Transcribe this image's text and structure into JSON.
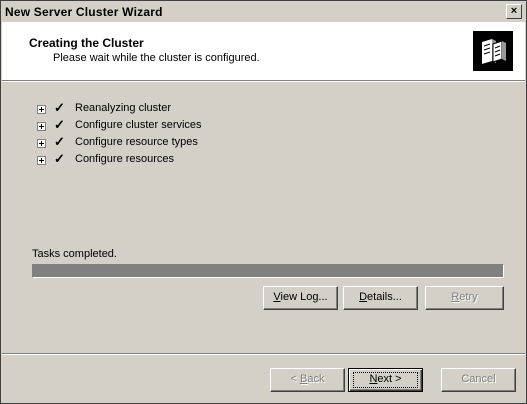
{
  "window": {
    "title": "New Server Cluster Wizard",
    "close_glyph": "×"
  },
  "header": {
    "title": "Creating the Cluster",
    "subtitle": "Please wait while the cluster is configured.",
    "icon": "cluster-server-icon"
  },
  "tasks": [
    {
      "label": "Reanalyzing cluster",
      "status": "completed"
    },
    {
      "label": "Configure cluster services",
      "status": "completed"
    },
    {
      "label": "Configure resource types",
      "status": "completed"
    },
    {
      "label": "Configure resources",
      "status": "completed"
    }
  ],
  "status_text": "Tasks completed.",
  "progress": {
    "percent": 100
  },
  "action_buttons": {
    "view_log": {
      "label": "iew Log...",
      "accel": "V"
    },
    "details": {
      "label": "etails...",
      "accel": "D"
    },
    "retry": {
      "label": "etry",
      "accel": "R",
      "enabled": false
    }
  },
  "nav_buttons": {
    "back": {
      "prefix": "< ",
      "accel": "B",
      "label": "ack",
      "enabled": false
    },
    "next": {
      "accel": "N",
      "label": "ext >",
      "enabled": true
    },
    "cancel": {
      "label": "Cancel",
      "enabled": false
    }
  }
}
